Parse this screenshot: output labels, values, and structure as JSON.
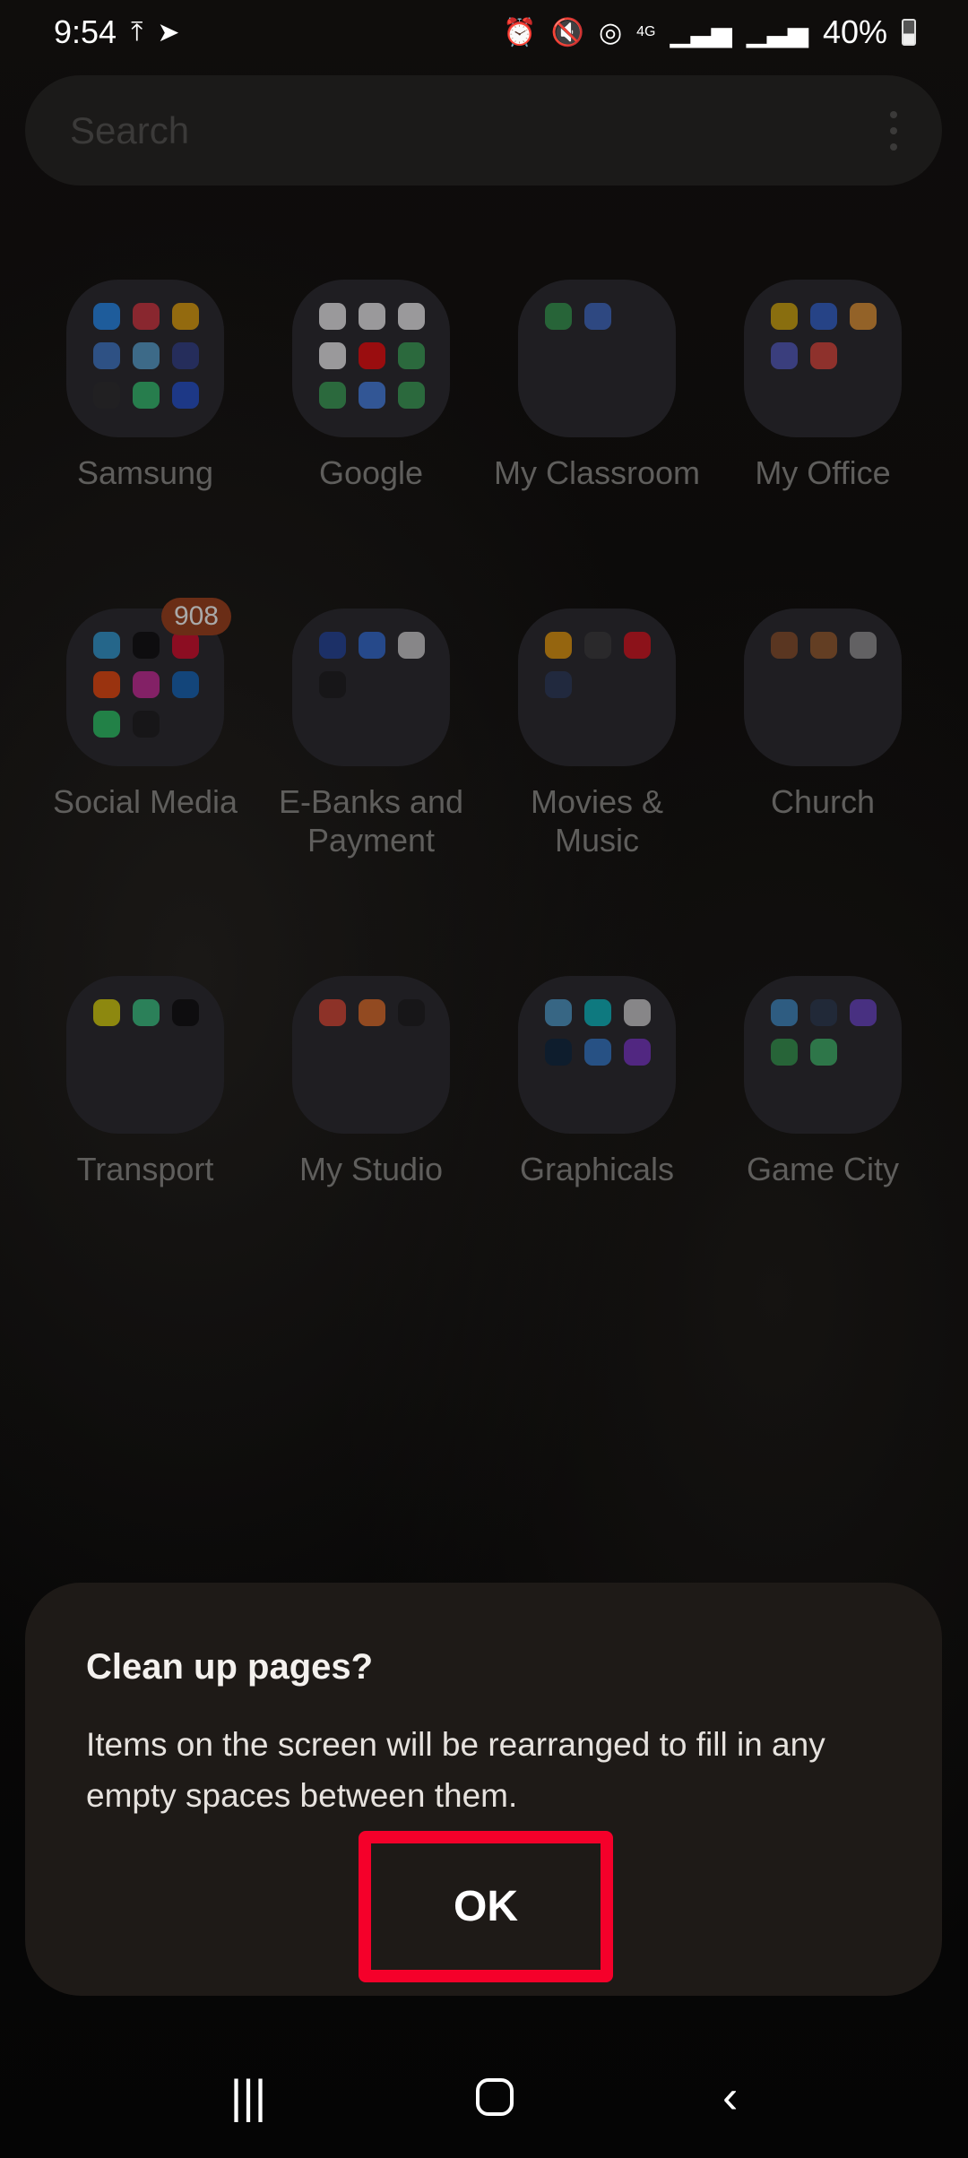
{
  "status_bar": {
    "time": "9:54",
    "battery": "40%",
    "network": "4G",
    "icons": [
      "upload-icon",
      "telegram-icon",
      "alarm-icon",
      "mute-icon",
      "hotspot-icon",
      "signal-icon",
      "signal-icon",
      "battery-icon"
    ]
  },
  "search": {
    "placeholder": "Search",
    "menu_icon": "more-vertical-icon"
  },
  "folders": [
    {
      "label": "Samsung",
      "apps": [
        "#1e90ff",
        "#e0303a",
        "#f2a900",
        "#3a7bd5",
        "#55aadd",
        "#2a3a8a",
        "#222",
        "#2ecc71",
        "#1c4fd8"
      ]
    },
    {
      "label": "Google",
      "apps": [
        "#ffffff",
        "#ffffff",
        "#ffffff",
        "#ffffff",
        "#ff0000",
        "#34a853",
        "#34a853",
        "#4285f4",
        "#34a853"
      ]
    },
    {
      "label": "My Classroom",
      "apps": [
        "#2e9e4a",
        "#3a6bd0"
      ]
    },
    {
      "label": "My Office",
      "apps": [
        "#e0b000",
        "#2b63d9",
        "#f29a2e",
        "#5059c9",
        "#e94235"
      ]
    },
    {
      "label": "Social Media",
      "badge": "908",
      "apps": [
        "#2aa3e0",
        "#000000",
        "#e60023",
        "#ff4500",
        "#d6249f",
        "#0a66c2",
        "#25d366",
        "#111111"
      ]
    },
    {
      "label": "E-Banks and Payment",
      "apps": [
        "#1a3fa0",
        "#2b6de0",
        "#dddddd",
        "#111111"
      ]
    },
    {
      "label": "Movies & Music",
      "apps": [
        "#f5a000",
        "#333333",
        "#e50914",
        "#223355"
      ]
    },
    {
      "label": "Church",
      "apps": [
        "#8a4a20",
        "#9a5a25",
        "#999999"
      ]
    },
    {
      "label": "Transport",
      "apps": [
        "#e8e000",
        "#34d186",
        "#000000"
      ]
    },
    {
      "label": "My Studio",
      "apps": [
        "#e8442e",
        "#f07020",
        "#111111"
      ]
    },
    {
      "label": "Graphicals",
      "apps": [
        "#4aa3d6",
        "#00c4cc",
        "#dddddd",
        "#001e36",
        "#2d7bd6",
        "#7a2fd0"
      ]
    },
    {
      "label": "Game City",
      "apps": [
        "#3a8fd0",
        "#22334a",
        "#6a3fd0",
        "#2e9e4a",
        "#3abf6a"
      ]
    }
  ],
  "dialog": {
    "title": "Clean up pages?",
    "message": "Items on the screen will be rearranged to fill in any empty spaces between them.",
    "ok_label": "OK",
    "highlight_color": "#f5002a"
  },
  "nav_bar": {
    "recents": "|||",
    "back": "‹"
  }
}
